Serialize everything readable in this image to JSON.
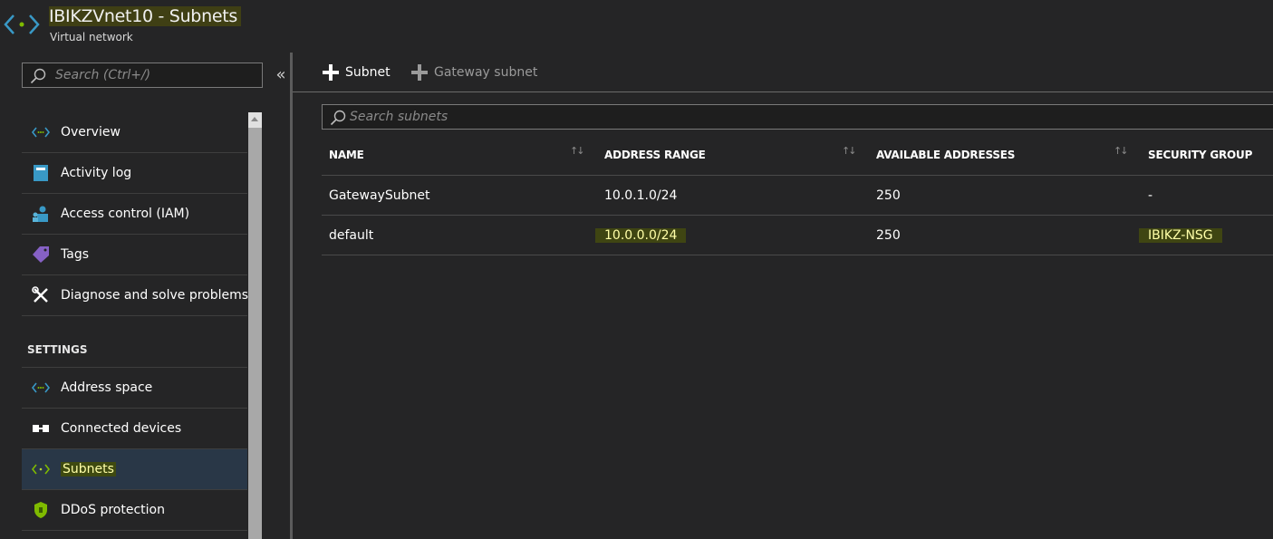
{
  "header": {
    "title": "IBIKZVnet10 - Subnets",
    "subtitle": "Virtual network",
    "icon": "virtual-network-icon"
  },
  "sidebar": {
    "search_placeholder": "Search (Ctrl+/)",
    "collapse_glyph": "«",
    "items": [
      {
        "label": "Overview",
        "icon": "overview-icon"
      },
      {
        "label": "Activity log",
        "icon": "activity-log-icon"
      },
      {
        "label": "Access control (IAM)",
        "icon": "access-control-icon"
      },
      {
        "label": "Tags",
        "icon": "tag-icon"
      },
      {
        "label": "Diagnose and solve problems",
        "icon": "wrench-icon"
      }
    ],
    "section_settings": "SETTINGS",
    "settings_items": [
      {
        "label": "Address space",
        "icon": "address-space-icon"
      },
      {
        "label": "Connected devices",
        "icon": "connected-devices-icon"
      },
      {
        "label": "Subnets",
        "icon": "subnets-icon",
        "active": true
      },
      {
        "label": "DDoS protection",
        "icon": "shield-icon"
      }
    ]
  },
  "toolbar": {
    "add_subnet": "Subnet",
    "add_gateway_subnet": "Gateway subnet"
  },
  "subnets": {
    "search_placeholder": "Search subnets",
    "columns": [
      "NAME",
      "ADDRESS RANGE",
      "AVAILABLE ADDRESSES",
      "SECURITY GROUP"
    ],
    "sort_glyph": "↑↓",
    "rows": [
      {
        "name": "GatewaySubnet",
        "address_range": "10.0.1.0/24",
        "available": "250",
        "security_group": "-"
      },
      {
        "name": "default",
        "address_range": "10.0.0.0/24",
        "available": "250",
        "security_group": "IBIKZ-NSG"
      }
    ]
  },
  "colors": {
    "background": "#252526",
    "accent_green": "#7fba00",
    "accent_blue": "#3999c6",
    "highlight": "#3f4512"
  }
}
